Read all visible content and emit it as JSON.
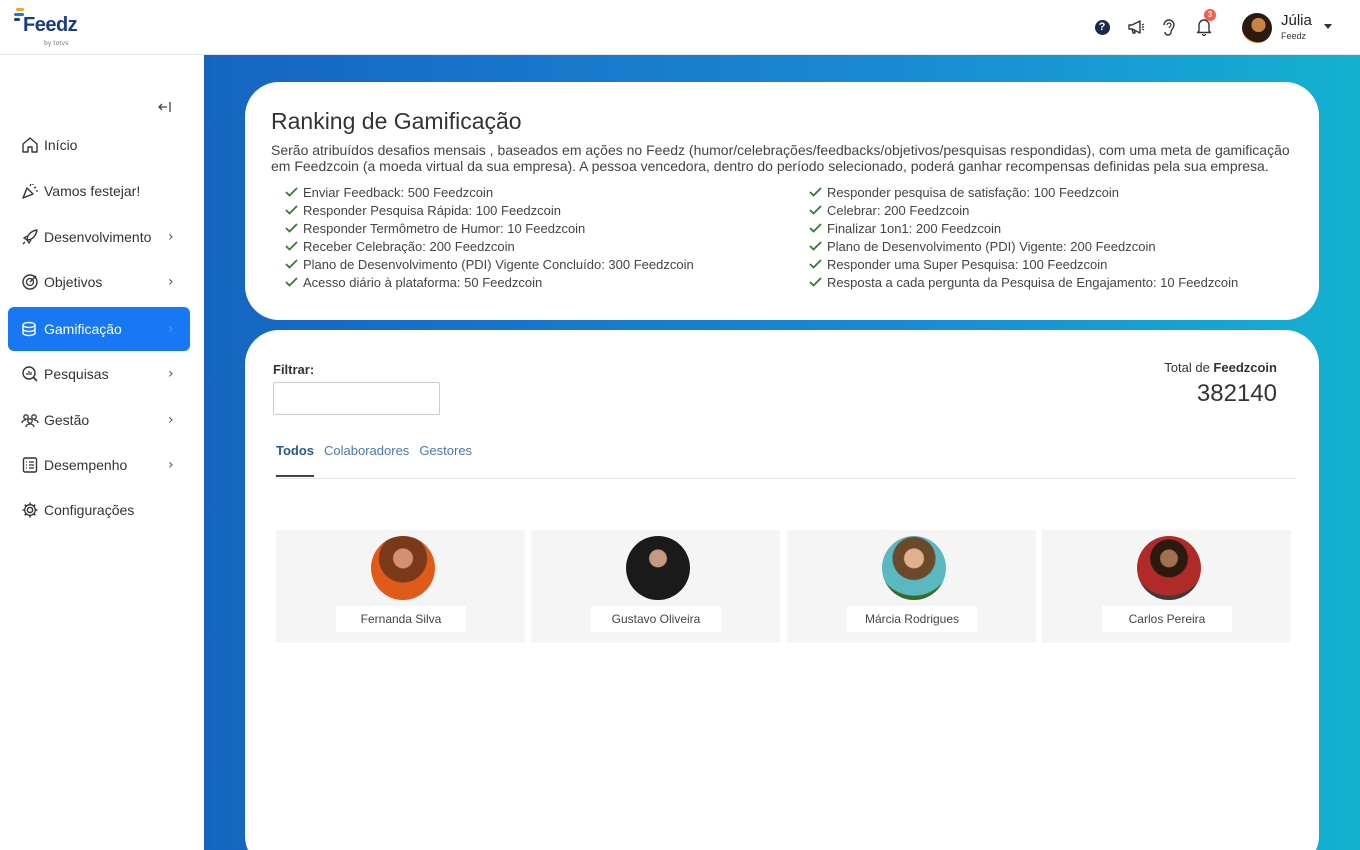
{
  "brand": {
    "name": "Feedz",
    "sub": "by totvs"
  },
  "topbar": {
    "notification_count": "3",
    "user_name": "Júlia",
    "user_org": "Feedz"
  },
  "sidebar": {
    "items": [
      {
        "label": "Início",
        "icon": "home-icon",
        "has_chevron": false
      },
      {
        "label": "Vamos festejar!",
        "icon": "party-icon",
        "has_chevron": false
      },
      {
        "label": "Desenvolvimento",
        "icon": "rocket-icon",
        "has_chevron": true
      },
      {
        "label": "Objetivos",
        "icon": "target-icon",
        "has_chevron": true
      },
      {
        "label": "Gamificação",
        "icon": "coins-icon",
        "has_chevron": true,
        "active": true
      },
      {
        "label": "Pesquisas",
        "icon": "search-chart-icon",
        "has_chevron": true
      },
      {
        "label": "Gestão",
        "icon": "people-icon",
        "has_chevron": true
      },
      {
        "label": "Desempenho",
        "icon": "checklist-icon",
        "has_chevron": true
      },
      {
        "label": "Configurações",
        "icon": "gear-icon",
        "has_chevron": false
      }
    ]
  },
  "ranking": {
    "title": "Ranking de Gamificação",
    "description": "Serão atribuídos desafios mensais , baseados em ações no Feedz (humor/celebrações/feedbacks/objetivos/pesquisas respondidas), com uma meta de gamificação em Feedzcoin (a moeda virtual da sua empresa). A pessoa vencedora, dentro do período selecionado, poderá ganhar recompensas definidas pela sua empresa.",
    "rules_left": [
      "Enviar Feedback: 500 Feedzcoin",
      "Responder Pesquisa Rápida: 100 Feedzcoin",
      "Responder Termômetro de Humor: 10 Feedzcoin",
      "Receber Celebração: 200 Feedzcoin",
      "Plano de Desenvolvimento (PDI) Vigente Concluído: 300 Feedzcoin",
      "Acesso diário à plataforma: 50 Feedzcoin"
    ],
    "rules_right": [
      "Responder pesquisa de satisfação: 100 Feedzcoin",
      "Celebrar: 200 Feedzcoin",
      "Finalizar 1on1: 200 Feedzcoin",
      "Plano de Desenvolvimento (PDI) Vigente: 200 Feedzcoin",
      "Responder uma Super Pesquisa: 100 Feedzcoin",
      "Resposta a cada pergunta da Pesquisa de Engajamento: 10 Feedzcoin"
    ]
  },
  "filter": {
    "label": "Filtrar:",
    "value": "",
    "total_prefix": "Total de ",
    "total_currency": "Feedzcoin",
    "total_value": "382140"
  },
  "tabs": [
    "Todos",
    "Colaboradores",
    "Gestores"
  ],
  "leaders": [
    {
      "name": "Fernanda Silva"
    },
    {
      "name": "Gustavo Oliveira"
    },
    {
      "name": "Márcia Rodrigues"
    },
    {
      "name": "Carlos Pereira"
    }
  ],
  "colors": {
    "accent": "#1877f2",
    "check": "#2e7d32",
    "brand_dark": "#1a3a8a"
  }
}
